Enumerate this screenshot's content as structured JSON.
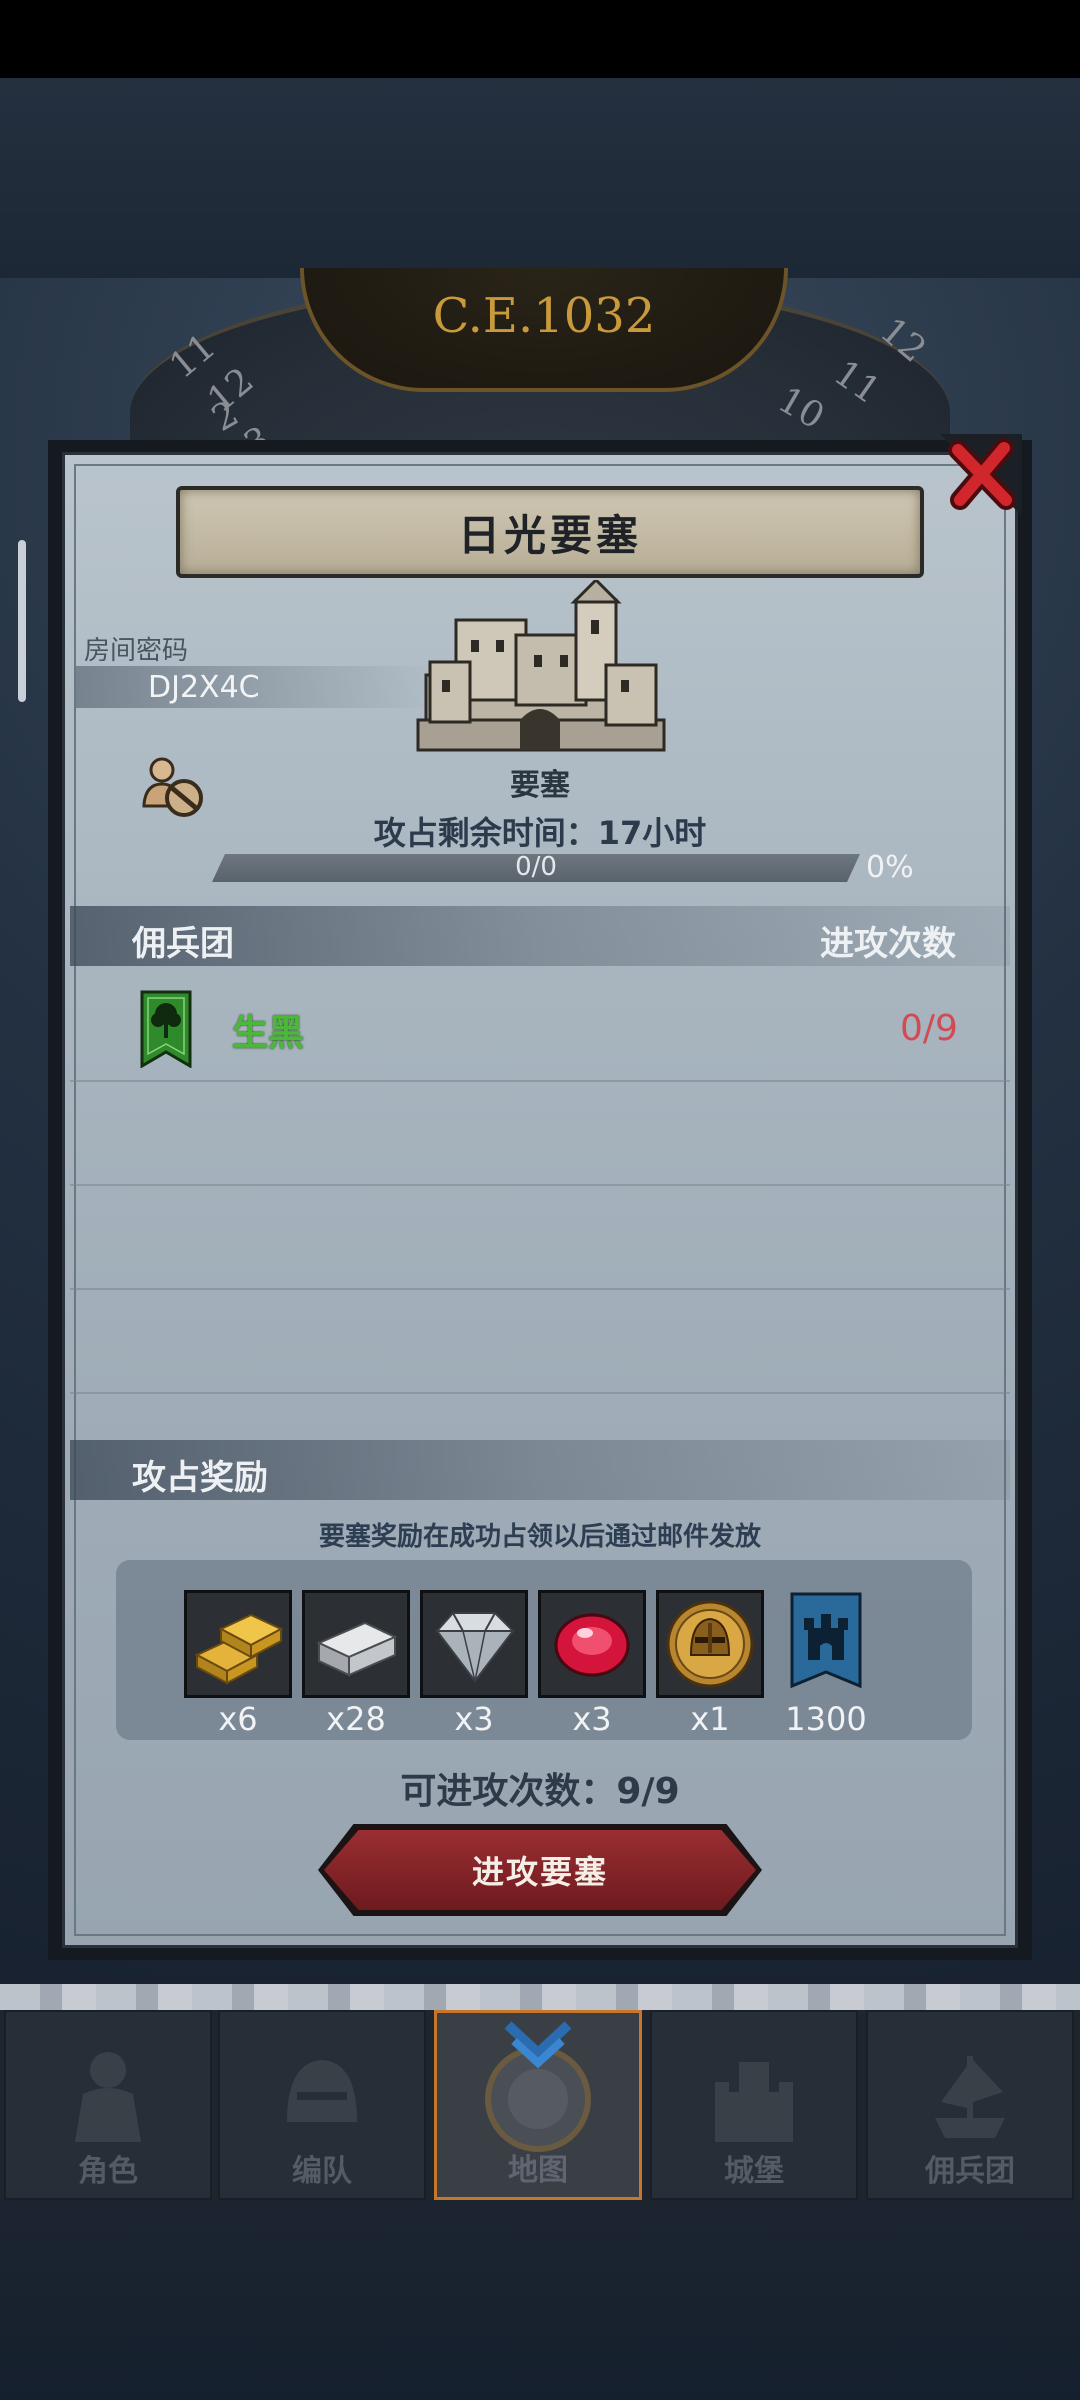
{
  "header": {
    "era": "C.E.1032",
    "dial_numbers": [
      "11",
      "12",
      "2",
      "3",
      "12",
      "10",
      "11"
    ]
  },
  "dialog": {
    "title": "日光要塞",
    "room_label": "房间密码",
    "room_code": "DJ2X4C",
    "fortress_label": "要塞",
    "time_left": "攻占剩余时间：17小时",
    "progress": {
      "text": "0/0",
      "percent_text": "0%",
      "fraction": 0
    },
    "mercenary": {
      "header_label": "佣兵团",
      "attacks_label": "进攻次数",
      "rows": [
        {
          "name": "生黑",
          "count": "0/9",
          "name_color": "#4cb83a",
          "count_color": "#d04b54"
        }
      ]
    },
    "rewards": {
      "header_label": "攻占奖励",
      "note": "要塞奖励在成功占领以后通过邮件发放",
      "items": [
        {
          "icon": "gold-bars-icon",
          "qty": "x6"
        },
        {
          "icon": "iron-bar-icon",
          "qty": "x28"
        },
        {
          "icon": "diamond-icon",
          "qty": "x3"
        },
        {
          "icon": "ruby-icon",
          "qty": "x3"
        },
        {
          "icon": "knight-helmet-medal-icon",
          "qty": "x1"
        },
        {
          "icon": "castle-banner-icon",
          "qty": "1300"
        }
      ]
    },
    "attempts": "可进攻次数：9/9",
    "attack_button": "进攻要塞"
  },
  "nav": {
    "items": [
      {
        "label": "角色",
        "icon": "knight-icon"
      },
      {
        "label": "编队",
        "icon": "helmet-icon"
      },
      {
        "label": "地图",
        "icon": "compass-icon",
        "active": true
      },
      {
        "label": "城堡",
        "icon": "castle-icon"
      },
      {
        "label": "佣兵团",
        "icon": "ship-icon"
      }
    ]
  }
}
